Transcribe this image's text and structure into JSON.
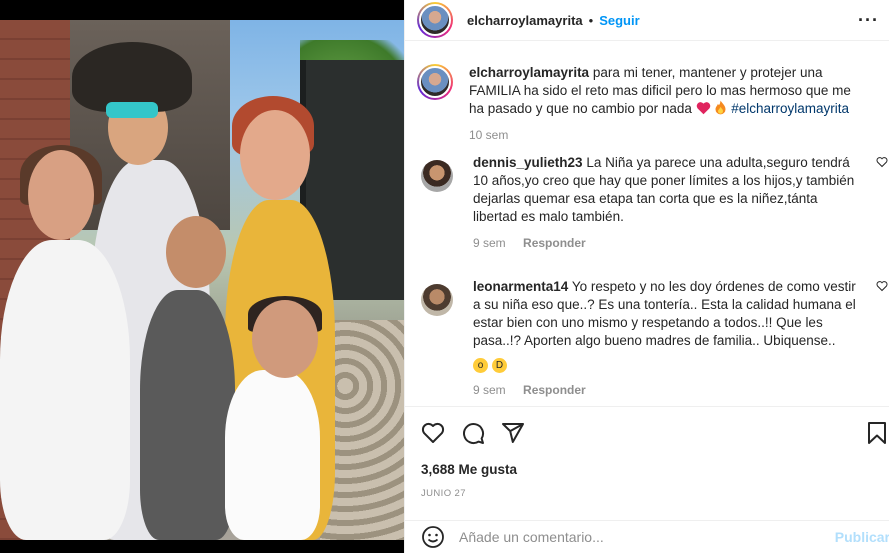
{
  "post": {
    "username": "elcharroylamayrita",
    "follow_label": "Seguir",
    "more_icon": "more-horizontal-icon"
  },
  "caption": {
    "username": "elcharroylamayrita",
    "text": "para mi tener, mantener y protejer una FAMILIA ha sido el reto mas dificil pero lo mas hermoso que me ha pasado y que no cambio por nada",
    "hashtag": "#elcharroylamayrita",
    "time": "10 sem"
  },
  "comments": [
    {
      "username": "dennis_yulieth23",
      "text": "La Niña ya parece una adulta,seguro tendrá 10 años,yo creo que hay que poner límites a los hijos,y también dejarlas quemar esa etapa tan corta que es la niñez,tánta libertad es malo también.",
      "time": "9 sem",
      "reply": "Responder"
    },
    {
      "username": "leonarmenta14",
      "text": "Yo respeto y no les doy órdenes de como vestir a su niña eso que..? Es una tontería.. Esta la calidad humana el estar bien con uno mismo y respetando a todos..!! Que les pasa..!? Aporten algo bueno madres de familia.. Ubiquense..",
      "time": "9 sem",
      "reply": "Responder"
    }
  ],
  "stats": {
    "likes": "3,688 Me gusta",
    "date": "JUNIO 27"
  },
  "composer": {
    "placeholder": "Añade un comentario...",
    "post_label": "Publicar"
  },
  "colors": {
    "accent": "#0095f6",
    "link": "#00376b",
    "muted": "#8e8e8e"
  }
}
